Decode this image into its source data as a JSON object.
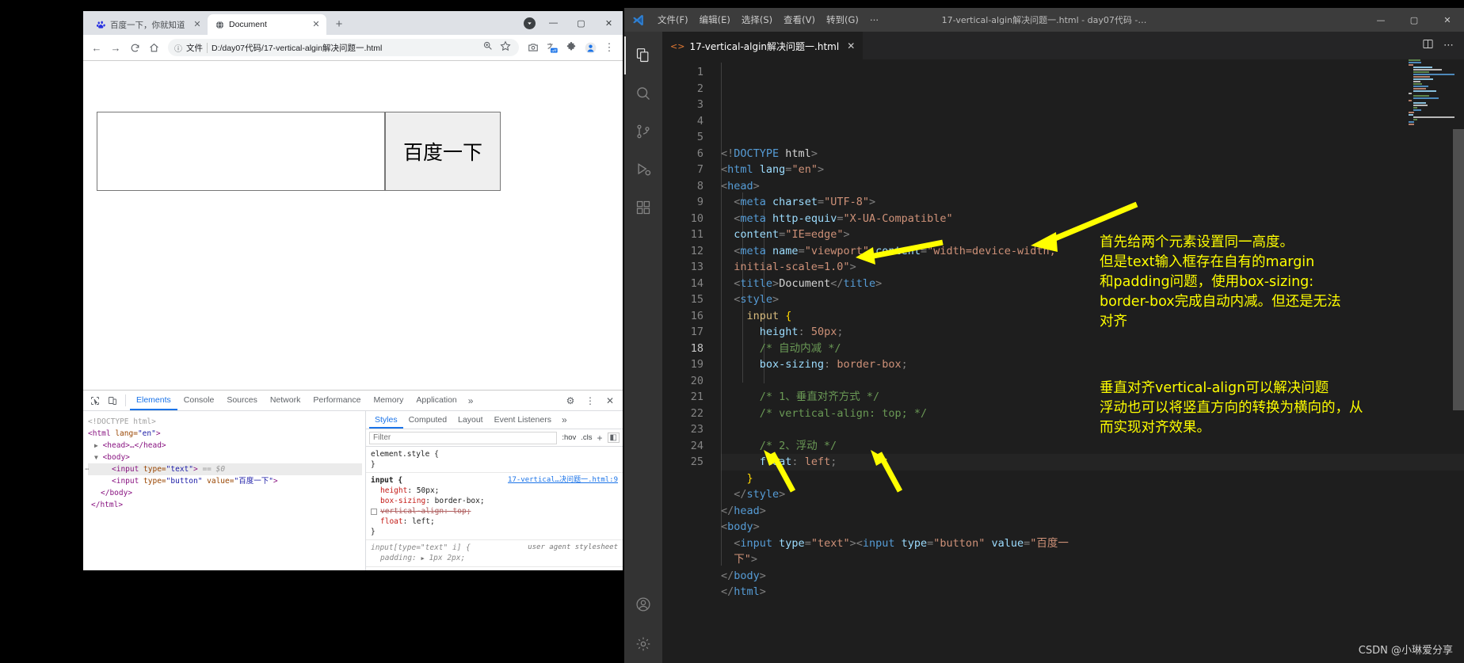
{
  "browser": {
    "tabs": [
      {
        "title": "百度一下，你就知道",
        "favicon": "baidu-paw-icon",
        "active": false
      },
      {
        "title": "Document",
        "favicon": "globe-icon",
        "active": true
      }
    ],
    "new_tab_label": "+",
    "window_buttons": {
      "minimize": "—",
      "maximize": "▢",
      "close": "✕"
    },
    "profile_badge": "▼",
    "toolbar": {
      "back": "←",
      "forward": "→",
      "reload": "C",
      "home": "⌂",
      "info_icon": "ⓘ",
      "file_label": "文件",
      "url": "D:/day07代码/17-vertical-algin解决问题一.html",
      "zoom_icon": "🔍",
      "bookmark_icon": "☆",
      "camera_icon": "📷",
      "translate_icon": "off",
      "extensions_icon": "🧩",
      "profile_icon": "👤",
      "menu_icon": "⋮"
    },
    "page": {
      "button_value": "百度一下"
    }
  },
  "devtools": {
    "tabs": [
      {
        "label": "Elements",
        "active": true
      },
      {
        "label": "Console",
        "active": false
      },
      {
        "label": "Sources",
        "active": false
      },
      {
        "label": "Network",
        "active": false
      },
      {
        "label": "Performance",
        "active": false
      },
      {
        "label": "Memory",
        "active": false
      },
      {
        "label": "Application",
        "active": false
      }
    ],
    "overflow": "»",
    "inspect_icon": "inspect-element-icon",
    "device_icon": "device-toolbar-icon",
    "settings_icon": "⚙",
    "kebab_icon": "⋮",
    "close_icon": "✕",
    "dom": {
      "l1": "<!DOCTYPE html>",
      "l2_open": "<html",
      "l2_attr": " lang=",
      "l2_val": "\"en\"",
      "l2_close": ">",
      "l3": "<head>…</head>",
      "l4": "<body>",
      "l5_tag": "<input",
      "l5_attr": " type=",
      "l5_val": "\"text\"",
      "l5_close": ">",
      "l5_selected": "== $0",
      "l6_tag": "<input",
      "l6_attr1": " type=",
      "l6_val1": "\"button\"",
      "l6_attr2": " value=",
      "l6_val2": "\"百度一下\"",
      "l6_close": ">",
      "l7": "</body>",
      "l8": "</html>"
    },
    "styles": {
      "tabs": [
        {
          "label": "Styles",
          "active": true
        },
        {
          "label": "Computed",
          "active": false
        },
        {
          "label": "Layout",
          "active": false
        },
        {
          "label": "Event Listeners",
          "active": false
        }
      ],
      "overflow": "»",
      "filter_placeholder": "Filter",
      "hov_label": ":hov",
      "cls_label": ".cls",
      "plus_label": "+",
      "panel_icon": "◧",
      "rule_element_style": "element.style {",
      "rule_element_close": "}",
      "rule_input_sel": "input {",
      "rule_input_source": "17-vertical…决问题一.html:9",
      "rule_input_props": [
        {
          "name": "height",
          "value": "50px",
          "disabled": false
        },
        {
          "name": "box-sizing",
          "value": "border-box",
          "disabled": false
        },
        {
          "name": "vertical-align",
          "value": "top",
          "disabled": true
        },
        {
          "name": "float",
          "value": "left",
          "disabled": false
        }
      ],
      "rule_input_close": "}",
      "rule_ua_sel": "input[type=\"text\" i] {",
      "rule_ua_source": "user agent stylesheet",
      "rule_ua_prop": "padding:",
      "rule_ua_val": "1px 2px;"
    }
  },
  "vscode": {
    "titlebar": {
      "logo": "vscode-logo-icon",
      "menus": [
        "文件(F)",
        "编辑(E)",
        "选择(S)",
        "查看(V)",
        "转到(G)",
        "⋯"
      ],
      "title": "17-vertical-algin解决问题一.html - day07代码 -…",
      "minimize": "—",
      "maximize": "▢",
      "close": "✕"
    },
    "activitybar": [
      {
        "name": "explorer-icon",
        "glyph": "files",
        "active": true
      },
      {
        "name": "search-icon",
        "glyph": "search",
        "active": false
      },
      {
        "name": "source-control-icon",
        "glyph": "branch",
        "active": false
      },
      {
        "name": "run-debug-icon",
        "glyph": "play",
        "active": false
      },
      {
        "name": "extensions-icon",
        "glyph": "blocks",
        "active": false
      },
      {
        "name": "accounts-icon",
        "glyph": "person",
        "active": false
      },
      {
        "name": "settings-gear-icon",
        "glyph": "gear",
        "active": false
      }
    ],
    "tab": {
      "icon": "html-file-icon",
      "label": "17-vertical-algin解决问题一.html",
      "close": "✕"
    },
    "tab_actions": {
      "split_editor": "▯",
      "more": "⋯"
    },
    "code_lines": [
      {
        "n": 1,
        "tokens": [
          [
            "t-punct",
            "<!"
          ],
          [
            "t-tag",
            "DOCTYPE"
          ],
          [
            "t-txt",
            " html"
          ],
          [
            "t-punct",
            ">"
          ]
        ]
      },
      {
        "n": 2,
        "tokens": [
          [
            "t-punct",
            "<"
          ],
          [
            "t-tag",
            "html"
          ],
          [
            "t-attr",
            " lang"
          ],
          [
            "t-punct",
            "="
          ],
          [
            "t-str",
            "\"en\""
          ],
          [
            "t-punct",
            ">"
          ]
        ]
      },
      {
        "n": 3,
        "tokens": [
          [
            "t-punct",
            "<"
          ],
          [
            "t-tag",
            "head"
          ],
          [
            "t-punct",
            ">"
          ]
        ]
      },
      {
        "n": 4,
        "tokens": [
          [
            "t-txt",
            "  "
          ],
          [
            "t-punct",
            "<"
          ],
          [
            "t-tag",
            "meta"
          ],
          [
            "t-attr",
            " charset"
          ],
          [
            "t-punct",
            "="
          ],
          [
            "t-str",
            "\"UTF-8\""
          ],
          [
            "t-punct",
            ">"
          ]
        ]
      },
      {
        "n": 5,
        "tokens": [
          [
            "t-txt",
            "  "
          ],
          [
            "t-punct",
            "<"
          ],
          [
            "t-tag",
            "meta"
          ],
          [
            "t-attr",
            " http-equiv"
          ],
          [
            "t-punct",
            "="
          ],
          [
            "t-str",
            "\"X-UA-Compatible\""
          ]
        ]
      },
      {
        "n": "",
        "tokens": [
          [
            "t-txt",
            "  "
          ],
          [
            "t-attr",
            "content"
          ],
          [
            "t-punct",
            "="
          ],
          [
            "t-str",
            "\"IE=edge\""
          ],
          [
            "t-punct",
            ">"
          ]
        ]
      },
      {
        "n": 6,
        "tokens": [
          [
            "t-txt",
            "  "
          ],
          [
            "t-punct",
            "<"
          ],
          [
            "t-tag",
            "meta"
          ],
          [
            "t-attr",
            " name"
          ],
          [
            "t-punct",
            "="
          ],
          [
            "t-str",
            "\"viewport\""
          ],
          [
            "t-attr",
            " content"
          ],
          [
            "t-punct",
            "="
          ],
          [
            "t-str",
            "\"width=device-width,"
          ]
        ]
      },
      {
        "n": "",
        "tokens": [
          [
            "t-txt",
            "  "
          ],
          [
            "t-str",
            "initial-scale=1.0\""
          ],
          [
            "t-punct",
            ">"
          ]
        ]
      },
      {
        "n": 7,
        "tokens": [
          [
            "t-txt",
            "  "
          ],
          [
            "t-punct",
            "<"
          ],
          [
            "t-tag",
            "title"
          ],
          [
            "t-punct",
            ">"
          ],
          [
            "t-txt",
            "Document"
          ],
          [
            "t-punct",
            "</"
          ],
          [
            "t-tag",
            "title"
          ],
          [
            "t-punct",
            ">"
          ]
        ]
      },
      {
        "n": 8,
        "tokens": [
          [
            "t-txt",
            "  "
          ],
          [
            "t-punct",
            "<"
          ],
          [
            "t-tag",
            "style"
          ],
          [
            "t-punct",
            ">"
          ]
        ]
      },
      {
        "n": 9,
        "tokens": [
          [
            "t-txt",
            "    "
          ],
          [
            "t-sel",
            "input"
          ],
          [
            "t-txt",
            " "
          ],
          [
            "t-brace",
            "{"
          ]
        ]
      },
      {
        "n": 10,
        "tokens": [
          [
            "t-txt",
            "      "
          ],
          [
            "t-prop",
            "height"
          ],
          [
            "t-punct",
            ": "
          ],
          [
            "t-val",
            "50px"
          ],
          [
            "t-punct",
            ";"
          ]
        ]
      },
      {
        "n": 11,
        "tokens": [
          [
            "t-txt",
            "      "
          ],
          [
            "t-cmt",
            "/* 自动内减 */"
          ]
        ]
      },
      {
        "n": 12,
        "tokens": [
          [
            "t-txt",
            "      "
          ],
          [
            "t-prop",
            "box-sizing"
          ],
          [
            "t-punct",
            ": "
          ],
          [
            "t-val",
            "border-box"
          ],
          [
            "t-punct",
            ";"
          ]
        ]
      },
      {
        "n": 13,
        "tokens": [
          [
            "t-txt",
            ""
          ]
        ]
      },
      {
        "n": 14,
        "tokens": [
          [
            "t-txt",
            "      "
          ],
          [
            "t-cmt",
            "/* 1、垂直对齐方式 */"
          ]
        ]
      },
      {
        "n": 15,
        "tokens": [
          [
            "t-txt",
            "      "
          ],
          [
            "t-cmt",
            "/* vertical-align: top; */"
          ]
        ]
      },
      {
        "n": 16,
        "tokens": [
          [
            "t-txt",
            ""
          ]
        ]
      },
      {
        "n": 17,
        "tokens": [
          [
            "t-txt",
            "      "
          ],
          [
            "t-cmt",
            "/* 2、浮动 */"
          ]
        ]
      },
      {
        "n": 18,
        "tokens": [
          [
            "t-txt",
            "      "
          ],
          [
            "t-prop",
            "float"
          ],
          [
            "t-punct",
            ": "
          ],
          [
            "t-val",
            "left"
          ],
          [
            "t-punct",
            ";"
          ]
        ],
        "current": true
      },
      {
        "n": 19,
        "tokens": [
          [
            "t-txt",
            "    "
          ],
          [
            "t-brace",
            "}"
          ]
        ]
      },
      {
        "n": 20,
        "tokens": [
          [
            "t-txt",
            "  "
          ],
          [
            "t-punct",
            "</"
          ],
          [
            "t-tag",
            "style"
          ],
          [
            "t-punct",
            ">"
          ]
        ]
      },
      {
        "n": 21,
        "tokens": [
          [
            "t-punct",
            "</"
          ],
          [
            "t-tag",
            "head"
          ],
          [
            "t-punct",
            ">"
          ]
        ]
      },
      {
        "n": 22,
        "tokens": [
          [
            "t-punct",
            "<"
          ],
          [
            "t-tag",
            "body"
          ],
          [
            "t-punct",
            ">"
          ]
        ]
      },
      {
        "n": 23,
        "tokens": [
          [
            "t-txt",
            "  "
          ],
          [
            "t-punct",
            "<"
          ],
          [
            "t-tag",
            "input"
          ],
          [
            "t-attr",
            " type"
          ],
          [
            "t-punct",
            "="
          ],
          [
            "t-str",
            "\"text\""
          ],
          [
            "t-punct",
            "><"
          ],
          [
            "t-tag",
            "input"
          ],
          [
            "t-attr",
            " type"
          ],
          [
            "t-punct",
            "="
          ],
          [
            "t-str",
            "\"button\""
          ],
          [
            "t-attr",
            " value"
          ],
          [
            "t-punct",
            "="
          ],
          [
            "t-str",
            "\"百度一"
          ]
        ]
      },
      {
        "n": "",
        "tokens": [
          [
            "t-txt",
            "  "
          ],
          [
            "t-str",
            "下\""
          ],
          [
            "t-punct",
            ">"
          ]
        ]
      },
      {
        "n": 24,
        "tokens": [
          [
            "t-punct",
            "</"
          ],
          [
            "t-tag",
            "body"
          ],
          [
            "t-punct",
            ">"
          ]
        ]
      },
      {
        "n": 25,
        "tokens": [
          [
            "t-punct",
            "</"
          ],
          [
            "t-tag",
            "html"
          ],
          [
            "t-punct",
            ">"
          ]
        ]
      }
    ]
  },
  "annotations": {
    "note1": "首先给两个元素设置同一高度。\n但是text输入框存在自有的margin\n和padding问题，使用box-sizing:\nborder-box完成自动内减。但还是无法\n对齐",
    "note2": "垂直对齐vertical-align可以解决问题\n浮动也可以将竖直方向的转换为横向的，从\n而实现对齐效果。",
    "color": "#ffff00"
  },
  "watermark": "CSDN @小琳爱分享"
}
